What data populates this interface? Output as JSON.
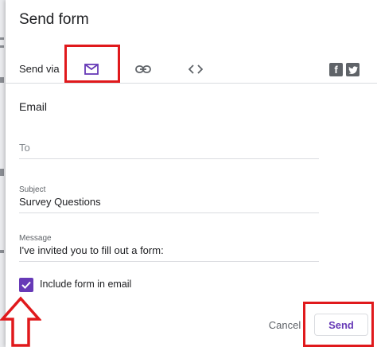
{
  "dialog": {
    "title": "Send form",
    "send_via_label": "Send via",
    "tabs": [
      {
        "name": "email",
        "icon": "mail-icon",
        "selected": true
      },
      {
        "name": "link",
        "icon": "link-icon",
        "selected": false
      },
      {
        "name": "embed",
        "icon": "code-icon",
        "selected": false
      }
    ],
    "social": {
      "facebook": "f",
      "twitter": "twitter-bird-icon"
    }
  },
  "email": {
    "section_title": "Email",
    "to": {
      "placeholder": "To",
      "value": ""
    },
    "subject": {
      "label": "Subject",
      "value": "Survey Questions"
    },
    "message": {
      "label": "Message",
      "value": "I've invited you to fill out a form:"
    },
    "include_form": {
      "label": "Include form in email",
      "checked": true
    }
  },
  "actions": {
    "cancel_label": "Cancel",
    "send_label": "Send"
  },
  "colors": {
    "accent": "#673ab7",
    "annotation": "#e0191c",
    "divider": "#dadce0"
  }
}
